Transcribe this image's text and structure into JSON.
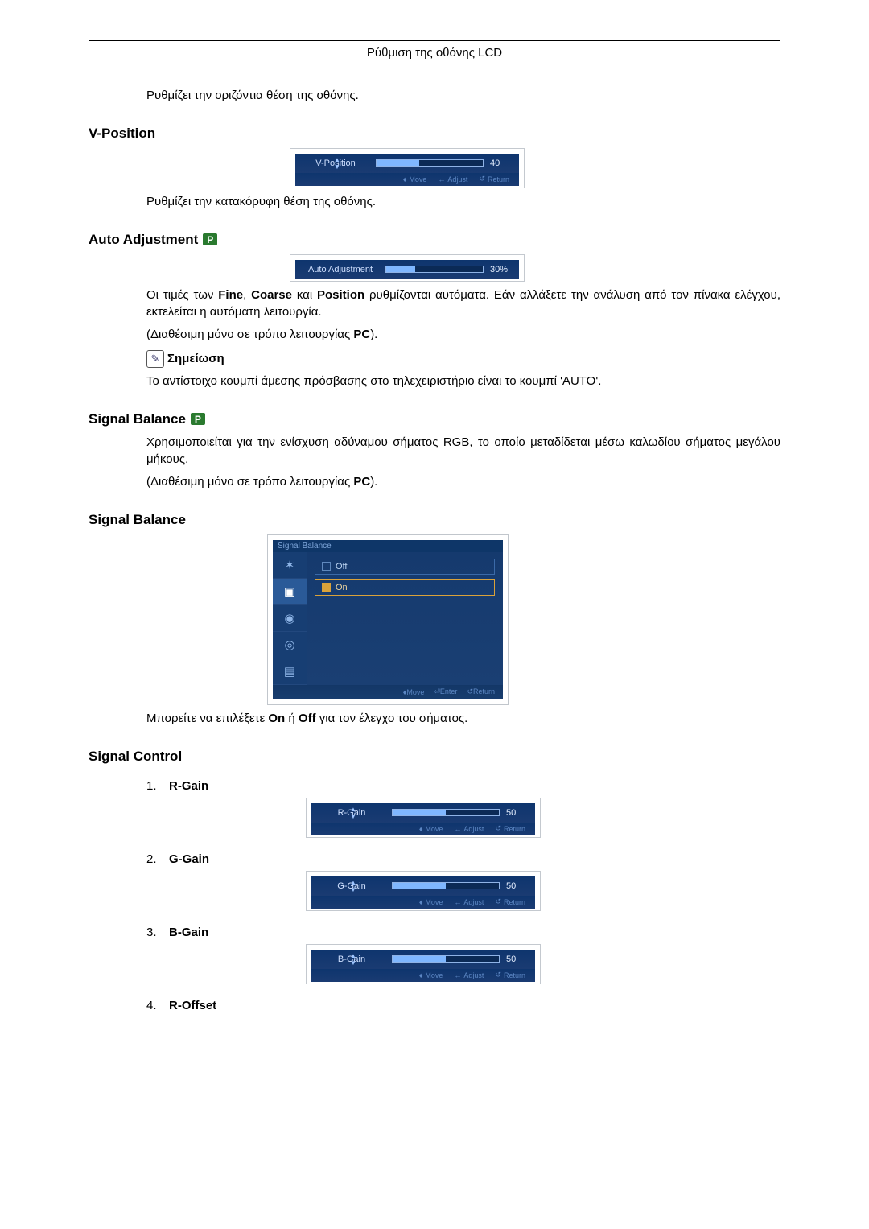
{
  "doc_title": "Ρύθμιση της οθόνης LCD",
  "intro_text": "Ρυθμίζει την οριζόντια θέση της οθόνης.",
  "vposition": {
    "heading": "V-Position",
    "osd_label": "V-Position",
    "value": "40",
    "fill_pct": 40,
    "foot_move": "Move",
    "foot_adjust": "Adjust",
    "foot_return": "Return",
    "desc": "Ρυθμίζει την κατακόρυφη θέση της οθόνης."
  },
  "autoadj": {
    "heading": "Auto Adjustment",
    "osd_label": "Auto Adjustment",
    "value": "30%",
    "fill_pct": 30,
    "para1_a": "Οι τιμές των ",
    "para1_b": "Fine",
    "para1_c": ", ",
    "para1_d": "Coarse",
    "para1_e": " και ",
    "para1_f": "Position",
    "para1_g": " ρυθμίζονται αυτόματα. Εάν αλλάξετε την ανάλυση από τον πίνακα ελέγχου, εκτελείται η αυτόματη λειτουργία.",
    "para2_a": "(Διαθέσιμη μόνο σε τρόπο λειτουργίας ",
    "para2_b": "PC",
    "para2_c": ").",
    "note_label": "Σημείωση",
    "para3": "Το αντίστοιχο κουμπί άμεσης πρόσβασης στο τηλεχειριστήριο είναι το κουμπί 'AUTO'."
  },
  "sigbal1": {
    "heading": "Signal Balance",
    "para1": "Χρησιμοποιείται για την ενίσχυση αδύναμου σήματος RGB, το οποίο μεταδίδεται μέσω καλωδίου σήματος μεγάλου μήκους.",
    "para2_a": "(Διαθέσιμη μόνο σε τρόπο λειτουργίας ",
    "para2_b": "PC",
    "para2_c": ")."
  },
  "sigbal2": {
    "heading": "Signal Balance",
    "menu_title": "Signal Balance",
    "opt_off": "Off",
    "opt_on": "On",
    "foot_move": "Move",
    "foot_enter": "Enter",
    "foot_return": "Return",
    "desc_a": "Μπορείτε να επιλέξετε ",
    "desc_b": "On",
    "desc_c": " ή ",
    "desc_d": "Off",
    "desc_e": " για τον έλεγχο του σήματος."
  },
  "sigctrl": {
    "heading": "Signal Control",
    "foot_move": "Move",
    "foot_adjust": "Adjust",
    "foot_return": "Return",
    "items": [
      {
        "num": "1.",
        "name": "R-Gain",
        "osd_label": "R-Gain",
        "value": "50",
        "fill_pct": 50
      },
      {
        "num": "2.",
        "name": "G-Gain",
        "osd_label": "G-Gain",
        "value": "50",
        "fill_pct": 50
      },
      {
        "num": "3.",
        "name": "B-Gain",
        "osd_label": "B-Gain",
        "value": "50",
        "fill_pct": 50
      },
      {
        "num": "4.",
        "name": "R-Offset"
      }
    ]
  }
}
